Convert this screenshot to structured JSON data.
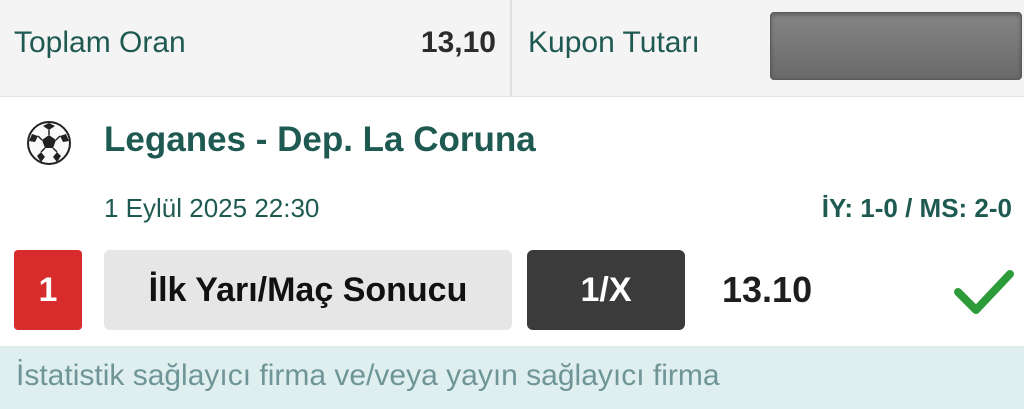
{
  "summary": {
    "total_odds_label": "Toplam Oran",
    "total_odds_value": "13,10",
    "coupon_amount_label": "Kupon Tutarı"
  },
  "match": {
    "sport_icon": "soccer-ball-icon",
    "title": "Leganes - Dep. La Coruna",
    "datetime": "1 Eylül 2025 22:30",
    "score": "İY: 1-0 / MS: 2-0"
  },
  "bet": {
    "pick_number": "1",
    "market": "İlk Yarı/Maç Sonucu",
    "selection": "1/X",
    "odd": "13.10",
    "status_icon": "check-icon"
  },
  "notice": {
    "text": "İstatistik sağlayıcı firma ve/veya yayın sağlayıcı firma"
  },
  "colors": {
    "title_green": "#1f5a52",
    "pick_red": "#d82b2b",
    "check_green": "#2e9b3a",
    "notice_bg": "#dfeff0"
  }
}
